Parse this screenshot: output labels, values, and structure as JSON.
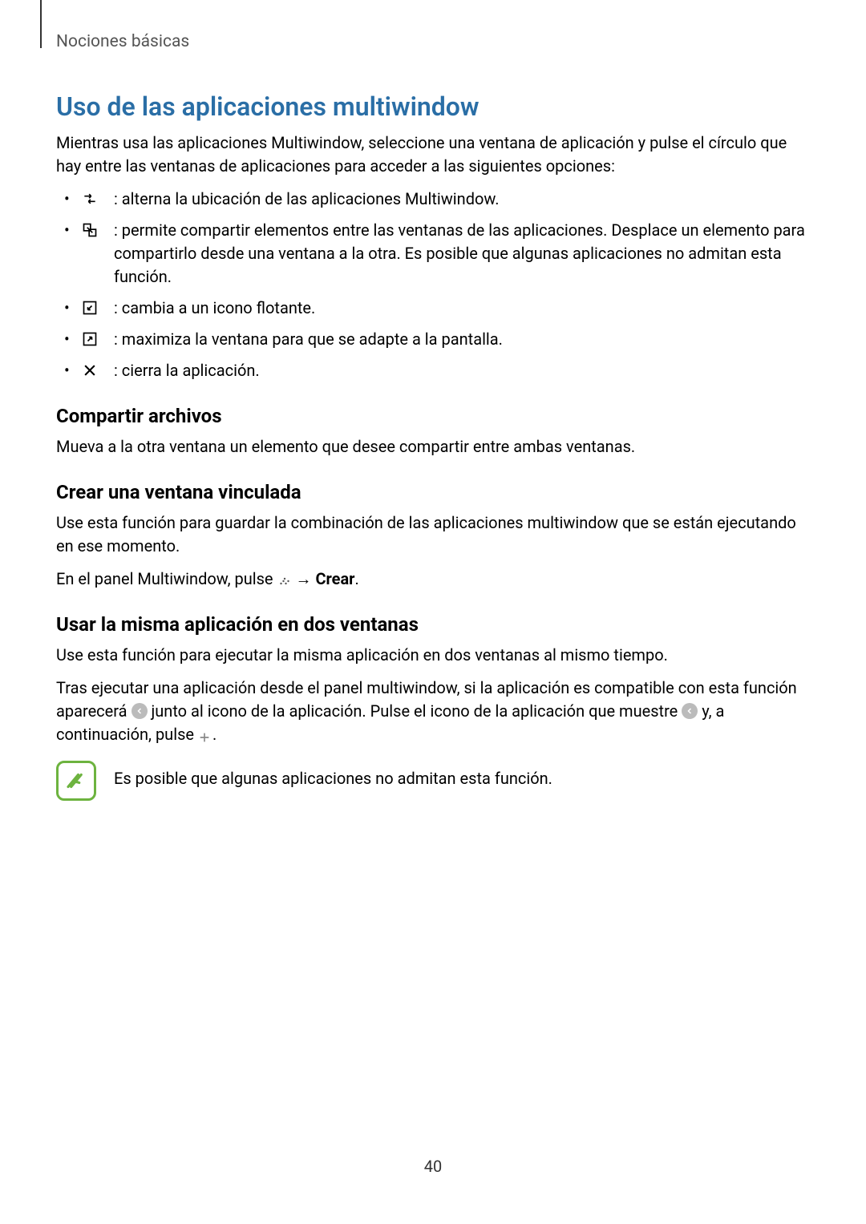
{
  "header": {
    "breadcrumb": "Nociones básicas"
  },
  "main": {
    "title": "Uso de las aplicaciones multiwindow",
    "intro": "Mientras usa las aplicaciones Multiwindow, seleccione una ventana de aplicación y pulse el círculo que hay entre las ventanas de aplicaciones para acceder a las siguientes opciones:",
    "options": [
      {
        "icon": "swap-icon",
        "text": " : alterna la ubicación de las aplicaciones Multiwindow."
      },
      {
        "icon": "share-window-icon",
        "text": " : permite compartir elementos entre las ventanas de las aplicaciones. Desplace un elemento para compartirlo desde una ventana a la otra. Es posible que algunas aplicaciones no admitan esta función."
      },
      {
        "icon": "float-icon",
        "text": " : cambia a un icono flotante."
      },
      {
        "icon": "maximize-icon",
        "text": " : maximiza la ventana para que se adapte a la pantalla."
      },
      {
        "icon": "close-icon",
        "text": " : cierra la aplicación."
      }
    ],
    "share_h": "Compartir archivos",
    "share_p": "Mueva a la otra ventana un elemento que desee compartir entre ambas ventanas.",
    "link_h": "Crear una ventana vinculada",
    "link_p": "Use esta función para guardar la combinación de las aplicaciones multiwindow que se están ejecutando en ese momento.",
    "link_inst_pre": "En el panel Multiwindow, pulse ",
    "link_inst_arrow": " → ",
    "link_inst_bold": "Crear",
    "link_inst_post": ".",
    "same_h": "Usar la misma aplicación en dos ventanas",
    "same_p1": "Use esta función para ejecutar la misma aplicación en dos ventanas al mismo tiempo.",
    "same_p2_a": "Tras ejecutar una aplicación desde el panel multiwindow, si la aplicación es compatible con esta función aparecerá ",
    "same_p2_b": " junto al icono de la aplicación. Pulse el icono de la aplicación que muestre ",
    "same_p2_c": " y, a continuación, pulse ",
    "same_p2_d": ".",
    "note": "Es posible que algunas aplicaciones no admitan esta función."
  },
  "page_number": "40"
}
